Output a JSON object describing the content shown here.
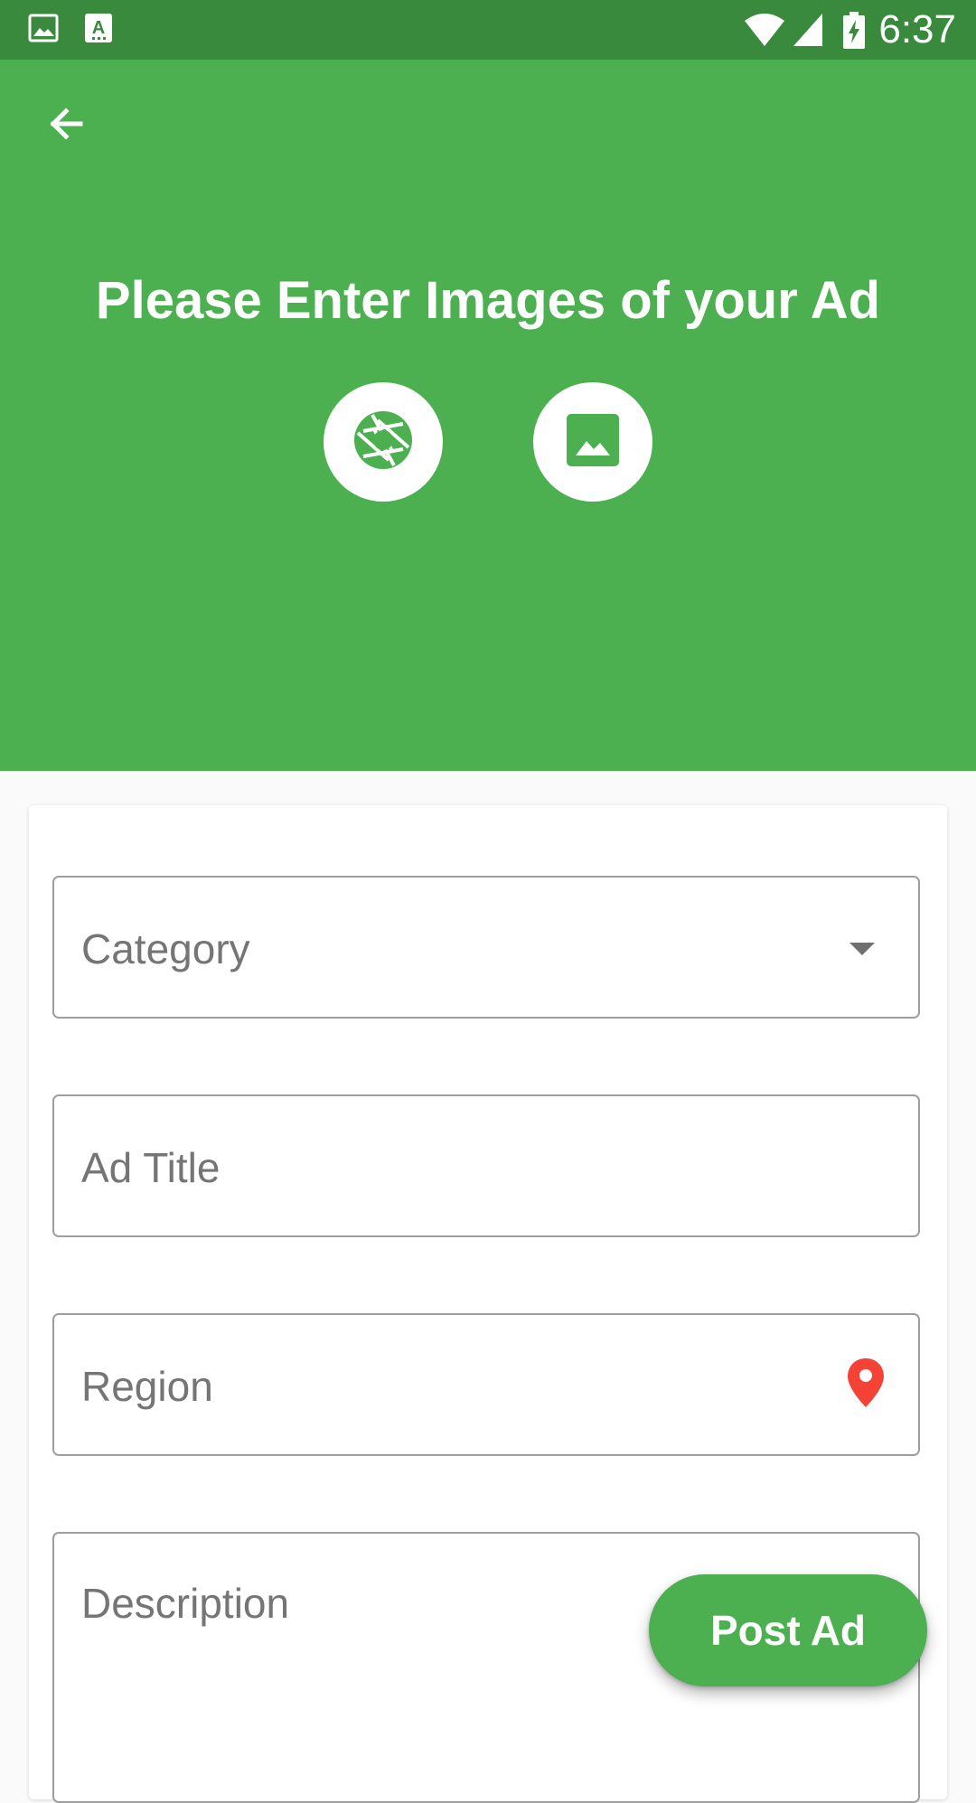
{
  "status_bar": {
    "time": "6:37",
    "icons": [
      "image-notification-icon",
      "text-notification-icon",
      "wifi-icon",
      "cell-signal-icon",
      "battery-charging-icon"
    ]
  },
  "header": {
    "title": "Please Enter Images of your Ad",
    "back_icon": "arrow-back-icon",
    "camera_icon": "camera-shutter-icon",
    "gallery_icon": "gallery-image-icon",
    "background_color": "#4caf50"
  },
  "form": {
    "category": {
      "label": "Category"
    },
    "ad_title": {
      "label": "Ad Title"
    },
    "region": {
      "label": "Region",
      "icon": "location-pin-icon",
      "icon_color": "#f44336"
    },
    "description": {
      "label": "Description"
    }
  },
  "fab": {
    "label": "Post Ad",
    "color": "#4caf50"
  }
}
